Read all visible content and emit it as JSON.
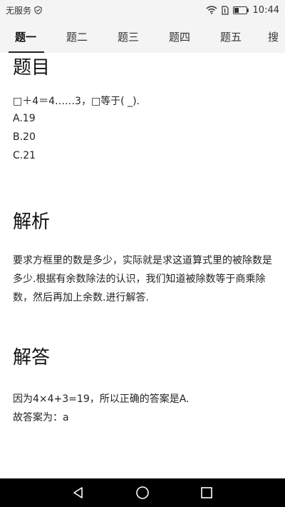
{
  "status_bar": {
    "carrier": "无服务",
    "time": "10:44"
  },
  "tabs": [
    {
      "label": "题一",
      "active": true
    },
    {
      "label": "题二",
      "active": false
    },
    {
      "label": "题三",
      "active": false
    },
    {
      "label": "题四",
      "active": false
    },
    {
      "label": "题五",
      "active": false
    },
    {
      "label": "搜",
      "active": false
    }
  ],
  "question": {
    "heading": "题目",
    "text": "□＋4＝4……3，□等于( _).",
    "options": [
      "A.19",
      "B.20",
      "C.21"
    ]
  },
  "analysis": {
    "heading": "解析",
    "text": "要求方框里的数是多少，实际就是求这道算式里的被除数是多少.根据有余数除法的认识，我们知道被除数等于商乘除数，然后再加上余数.进行解答."
  },
  "answer": {
    "heading": "解答",
    "line1": "因为4×4+3=19，所以正确的答案是A.",
    "line2": "故答案为：a"
  },
  "icons": {
    "nav_back": "back-triangle-icon",
    "nav_home": "home-circle-icon",
    "nav_recents": "recents-square-icon"
  }
}
